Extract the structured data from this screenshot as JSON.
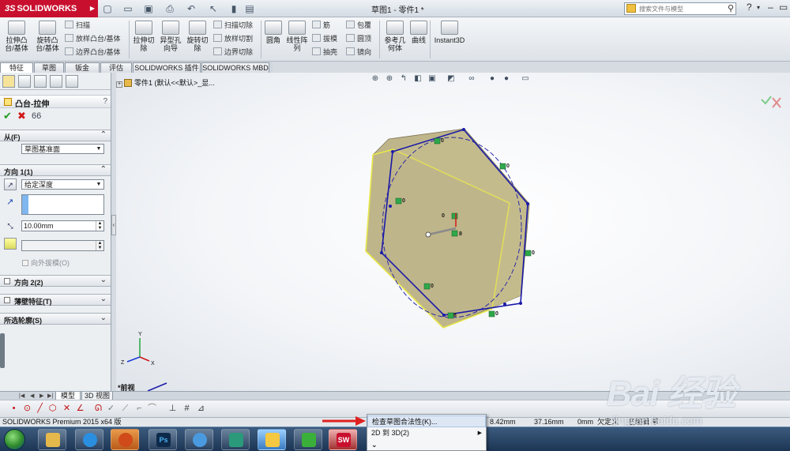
{
  "titlebar": {
    "logo": "SOLIDWORKS",
    "logo_mark": "3S",
    "document_title": "草图1 - 零件1 *",
    "search_placeholder": "搜索文件与模型",
    "help": "?"
  },
  "command_manager": {
    "extrude_boss": "拉伸凸\n台/基体",
    "revolve_boss": "旋转凸\n台/基体",
    "sweep": "扫描",
    "loft_boss": "放样凸台/基体",
    "boundary_boss": "边界凸台/基体",
    "extrude_cut": "拉伸切\n除",
    "hole_wizard": "异型孔\n向导",
    "revolve_cut": "旋转切\n除",
    "swept_cut": "扫描切除",
    "lofted_cut": "放样切割",
    "boundary_cut": "边界切除",
    "fillet": "圆角",
    "linear_pattern": "线性阵\n列",
    "rib": "筋",
    "draft": "拔模",
    "shell": "抽壳",
    "wrap": "包覆",
    "dome": "圆顶",
    "mirror": "镜向",
    "reference_geometry": "参考几\n何体",
    "curves": "曲线",
    "instant3d": "Instant3D"
  },
  "tabs": [
    {
      "label": "特征"
    },
    {
      "label": "草图"
    },
    {
      "label": "钣金"
    },
    {
      "label": "评估"
    },
    {
      "label": "SOLIDWORKS 插件"
    },
    {
      "label": "SOLIDWORKS MBD"
    }
  ],
  "property_manager": {
    "title": "凸台-拉伸",
    "help": "?",
    "from": {
      "label": "从(F)",
      "value": "草图基准面"
    },
    "direction1": {
      "label": "方向 1(1)",
      "end_condition": "给定深度",
      "depth": "10.00mm",
      "draft_outward": "向外拔模(O)"
    },
    "direction2": {
      "label": "方向 2(2)"
    },
    "thin_feature": {
      "label": "薄壁特征(T)"
    },
    "selected_contours": {
      "label": "所选轮廓(S)"
    }
  },
  "viewport": {
    "tree_root": "零件1 (默认<<默认>_显...",
    "view_name": "*前视",
    "relation_labels": [
      "0",
      "0",
      "0",
      "0",
      "0",
      "0",
      "0",
      "8",
      "8"
    ]
  },
  "model_tabs": [
    {
      "label": "模型"
    },
    {
      "label": "3D 视图"
    }
  ],
  "statusbar": {
    "product": "SOLIDWORKS Premium 2015 x64 版",
    "x": "8.42mm",
    "y": "37.16mm",
    "z": "0mm",
    "state": "欠定义",
    "editing": "在编辑 草"
  },
  "context_menu": {
    "items": [
      {
        "label": "检查草图合法性(K)..."
      },
      {
        "label": "2D 到 3D(2)"
      }
    ],
    "more": "⌄"
  },
  "taskbar": {
    "photoshop": "Ps",
    "solidworks": "SW"
  },
  "watermark": {
    "brand": "Bai 经验",
    "url": "jingyan.baidu.com"
  },
  "colors": {
    "solidworks_red": "#c8102e",
    "sketch_blue": "#1a1aa8",
    "model_face": "#bfb58a",
    "preview_yellow": "#e8e84a",
    "relation_green": "#2fa84a"
  }
}
